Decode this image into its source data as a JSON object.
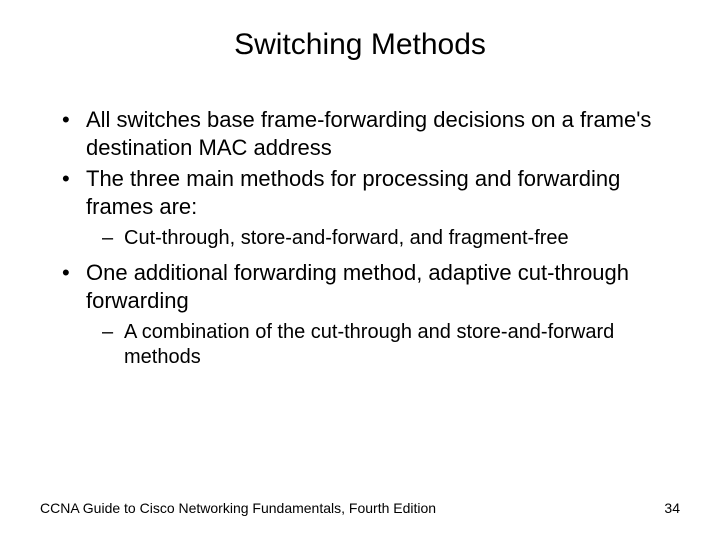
{
  "title": "Switching Methods",
  "bullets": {
    "b1": "All switches base frame-forwarding decisions on a frame's destination MAC address",
    "b2": "The three main methods for processing and forwarding frames are:",
    "b2_sub1": "Cut-through, store-and-forward, and fragment-free",
    "b3": "One additional forwarding method, adaptive cut-through forwarding",
    "b3_sub1": "A combination of the cut-through and store-and-forward methods"
  },
  "footer": {
    "source": "CCNA Guide to Cisco Networking Fundamentals, Fourth Edition",
    "page": "34"
  }
}
